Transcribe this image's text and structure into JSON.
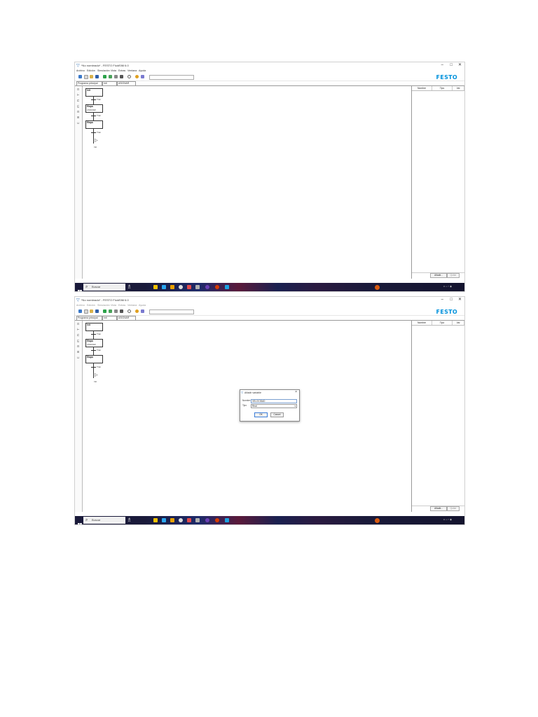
{
  "window": {
    "title": "*No nombrado* - FESTO FluidSIM 6.0",
    "controls": [
      "–",
      "□",
      "✕"
    ]
  },
  "menu": [
    "Archivo",
    "Edición",
    "Simulación",
    "Vista",
    "Extras",
    "Ventana",
    "Ayuda"
  ],
  "toolbar": {
    "combo_value": "",
    "brand": "FESTO"
  },
  "tabs": [
    "Programa principal",
    "Init",
    "ASIGNAR"
  ],
  "grafcet": {
    "steps": [
      {
        "label": "Init",
        "action": ""
      },
      {
        "label": "Etapa",
        "action": "ASIGNAR"
      },
      {
        "label": "Etapa",
        "action": ""
      }
    ],
    "transitions": [
      "Tran",
      "Tran",
      "Tran"
    ],
    "jump_label": "Init"
  },
  "variables_panel": {
    "columns": [
      "Nombre",
      "Tipo",
      "Val"
    ],
    "buttons": [
      "Añadir...",
      "Quitar"
    ]
  },
  "taskbar": {
    "search_placeholder": "Buscar",
    "app_colors": [
      "#f2c200",
      "#2aa7f0",
      "#e8a000",
      "#dddddd",
      "#e34a4a",
      "#b0b0b0",
      "#6a3fb5",
      "#d83b01",
      "#1ba1e2"
    ],
    "tray": "∧ ⌂ ⌐ ◉",
    "clock_time": "",
    "clock_date": ""
  },
  "dialog": {
    "title": "Añadir variable",
    "name_label": "Nombre",
    "name_value": "VELOCIDAD",
    "type_label": "Tipo",
    "type_value": "Real",
    "ok_label": "OK",
    "cancel_label": "Cancel"
  }
}
